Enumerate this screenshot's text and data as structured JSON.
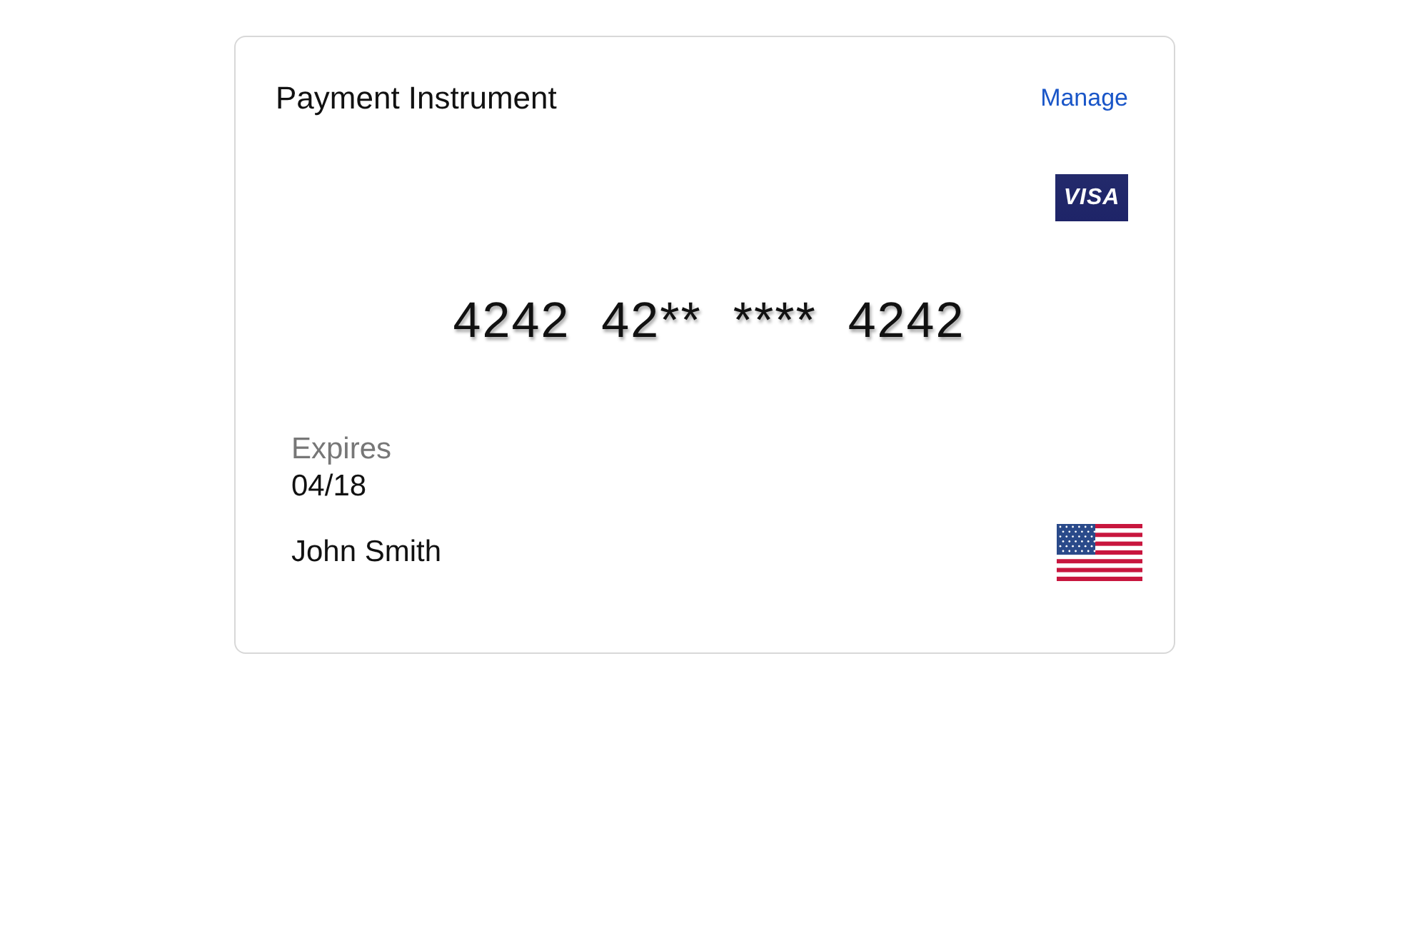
{
  "card": {
    "title": "Payment Instrument",
    "manage_link": "Manage",
    "brand_logo": "VISA",
    "number_groups": [
      "4242",
      "42**",
      "****",
      "4242"
    ],
    "expires_label": "Expires",
    "expires_value": "04/18",
    "holder_name": "John Smith"
  }
}
